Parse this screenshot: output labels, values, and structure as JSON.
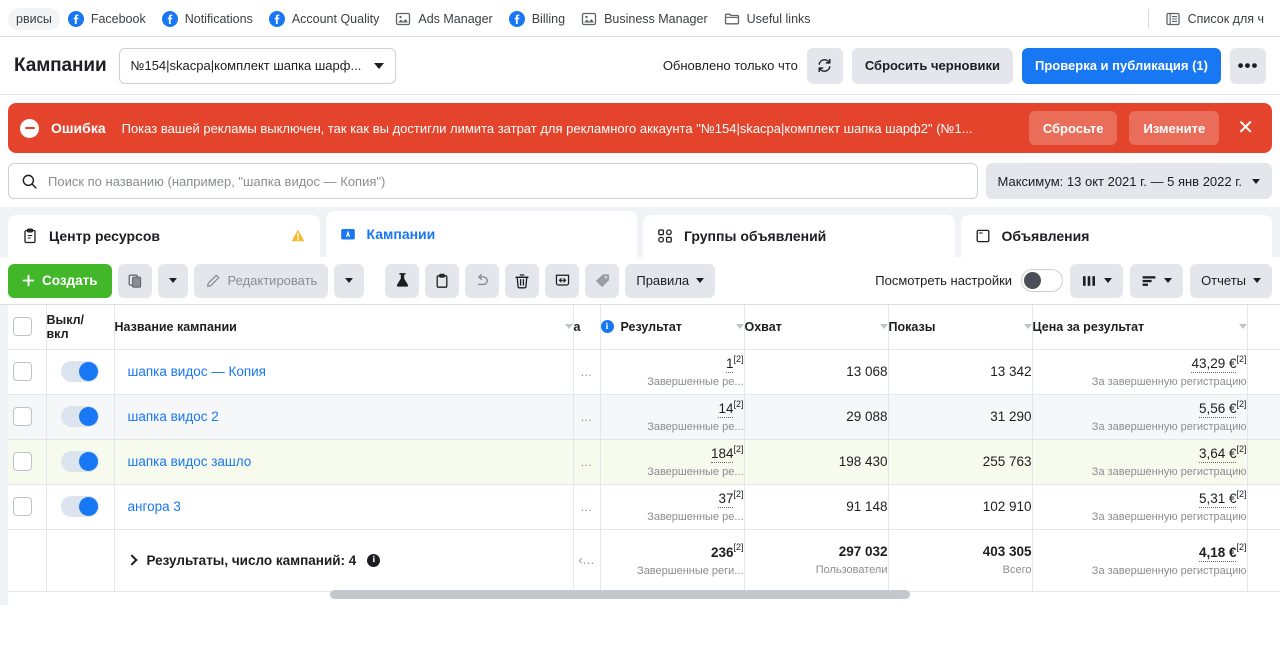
{
  "bookmarks": {
    "items": [
      {
        "label": "рвисы",
        "icon": "pill-shortcut",
        "pill": true
      },
      {
        "label": "Facebook",
        "icon": "facebook-icon"
      },
      {
        "label": "Notifications",
        "icon": "facebook-icon"
      },
      {
        "label": "Account Quality",
        "icon": "facebook-icon"
      },
      {
        "label": "Ads Manager",
        "icon": "image-icon"
      },
      {
        "label": "Billing",
        "icon": "facebook-icon"
      },
      {
        "label": "Business Manager",
        "icon": "image-icon"
      },
      {
        "label": "Useful links",
        "icon": "folder-icon"
      }
    ],
    "right": [
      {
        "label": "Список для ч",
        "icon": "reading-list-icon"
      }
    ]
  },
  "header": {
    "title": "Кампании",
    "account": "№154|skacpa|комплект шапка шарф...",
    "updated": "Обновлено только что",
    "refresh_icon": "refresh-icon",
    "discard_label": "Сбросить черновики",
    "publish_label": "Проверка и публикация (1)",
    "more_label": "•••"
  },
  "error": {
    "icon": "error-icon",
    "label": "Ошибка",
    "message": "Показ вашей рекламы выключен, так как вы достигли лимита затрат для рекламного аккаунта \"№154|skacpa|комплект шапка шарф2\" (№1...",
    "reset_label": "Сбросьте",
    "change_label": "Измените",
    "close_icon": "close-icon",
    "bg_color": "#e4442c"
  },
  "search": {
    "icon": "search-icon",
    "value": "",
    "placeholder": "Поиск по названию (например, \"шапка видос — Копия\")",
    "date_range": "Максимум: 13 окт 2021 г. — 5 янв 2022 г."
  },
  "tabs": [
    {
      "label": "Центр ресурсов",
      "icon": "clipboard-icon",
      "active": false,
      "warning": true
    },
    {
      "label": "Кампании",
      "icon": "campaign-folder-icon",
      "active": true,
      "warning": false
    },
    {
      "label": "Группы объявлений",
      "icon": "adsets-icon",
      "active": false,
      "warning": false
    },
    {
      "label": "Объявления",
      "icon": "ads-icon",
      "active": false,
      "warning": false
    }
  ],
  "toolbar": {
    "create_label": "Создать",
    "create_icon": "plus-icon",
    "duplicate_icon": "duplicate-icon",
    "duplicate_caret_icon": "chevron-down-icon",
    "edit_label": "Редактировать",
    "edit_icon": "pencil-icon",
    "edit_caret_icon": "chevron-down-icon",
    "ab_test_icon": "flask-icon",
    "copy_icon": "clipboard-icon",
    "undo_icon": "undo-icon",
    "delete_icon": "trash-icon",
    "export_icon": "export-icon",
    "tag_icon": "tag-icon",
    "rules_label": "Правила",
    "rules_caret_icon": "chevron-down-icon",
    "settings_label": "Посмотреть настройки",
    "settings_toggle": "toggle-off",
    "columns_icon": "columns-icon",
    "columns_caret_icon": "chevron-down-icon",
    "breakdown_icon": "breakdown-icon",
    "breakdown_caret_icon": "chevron-down-icon",
    "reports_label": "Отчеты",
    "reports_caret_icon": "chevron-down-icon"
  },
  "table": {
    "headers": {
      "toggle": "Выкл/\nвкл",
      "toggle_line1": "Выкл/",
      "toggle_line2": "вкл",
      "name": "Название кампании",
      "partial": "а",
      "result": "Результат",
      "reach": "Охват",
      "impressions": "Показы",
      "cost_per_result": "Цена за результат"
    },
    "rows": [
      {
        "name": "шапка видос — Копия",
        "enabled": true,
        "result": "1",
        "result_sup": "[2]",
        "result_sub": "Завершенные ре...",
        "reach": "13 068",
        "impressions": "13 342",
        "cpr": "43,29 €",
        "cpr_sup": "[2]",
        "cpr_sub": "За завершенную регистрацию",
        "dots": "..."
      },
      {
        "name": "шапка видос 2",
        "enabled": true,
        "result": "14",
        "result_sup": "[2]",
        "result_sub": "Завершенные ре...",
        "reach": "29 088",
        "impressions": "31 290",
        "cpr": "5,56 €",
        "cpr_sup": "[2]",
        "cpr_sub": "За завершенную регистрацию",
        "dots": "..."
      },
      {
        "name": "шапка видос зашло",
        "enabled": true,
        "result": "184",
        "result_sup": "[2]",
        "result_sub": "Завершенные ре...",
        "reach": "198 430",
        "impressions": "255 763",
        "cpr": "3,64 €",
        "cpr_sup": "[2]",
        "cpr_sub": "За завершенную регистрацию",
        "dots": "..."
      },
      {
        "name": "ангора 3",
        "enabled": true,
        "result": "37",
        "result_sup": "[2]",
        "result_sub": "Завершенные ре...",
        "reach": "91 148",
        "impressions": "102 910",
        "cpr": "5,31 €",
        "cpr_sup": "[2]",
        "cpr_sub": "За завершенную регистрацию",
        "dots": "..."
      }
    ],
    "totals": {
      "label": "Результаты, число кампаний: 4",
      "info_icon": "info-icon",
      "dots": "‹...",
      "result": "236",
      "result_sup": "[2]",
      "result_sub": "Завершенные реги...",
      "reach": "297 032",
      "reach_sub": "Пользователи",
      "impressions": "403 305",
      "impressions_sub": "Всего",
      "cpr": "4,18 €",
      "cpr_sup": "[2]",
      "cpr_sub": "За завершенную регистрацию"
    }
  }
}
